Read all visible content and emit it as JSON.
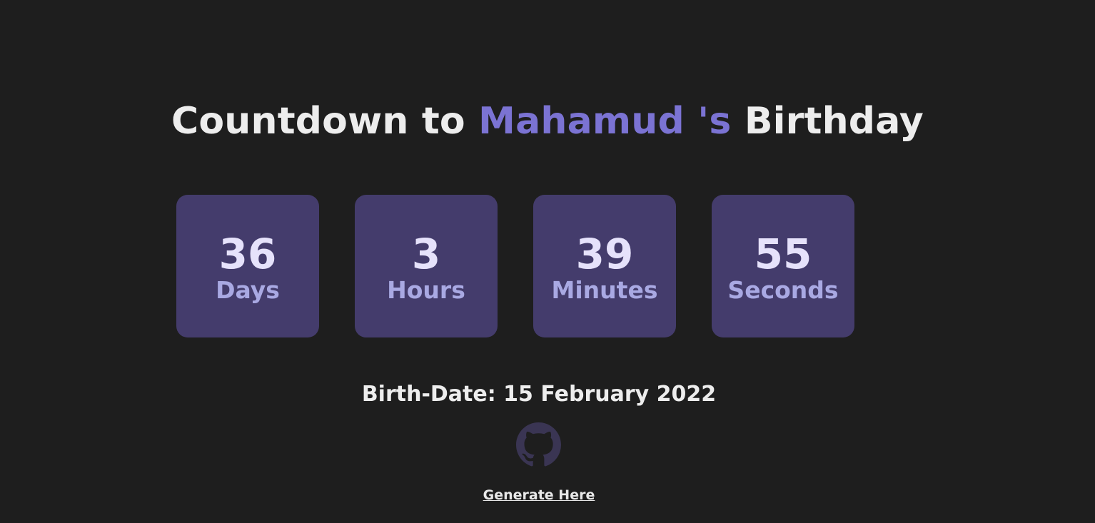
{
  "title": {
    "prefix": "Countdown to ",
    "name": "Mahamud 's",
    "suffix": " Birthday"
  },
  "countdown": [
    {
      "value": "36",
      "unit": "Days"
    },
    {
      "value": "3",
      "unit": "Hours"
    },
    {
      "value": "39",
      "unit": "Minutes"
    },
    {
      "value": "55",
      "unit": "Seconds"
    }
  ],
  "birth_date": "Birth-Date: 15 February 2022",
  "github_icon": "github-icon",
  "generate_link": "Generate Here",
  "colors": {
    "background": "#1e1e1e",
    "accent": "#7b73d3",
    "box": "#443c6c",
    "number": "#e6e2fb",
    "unit": "#a9a9e3",
    "github_icon": "#3a3553"
  }
}
